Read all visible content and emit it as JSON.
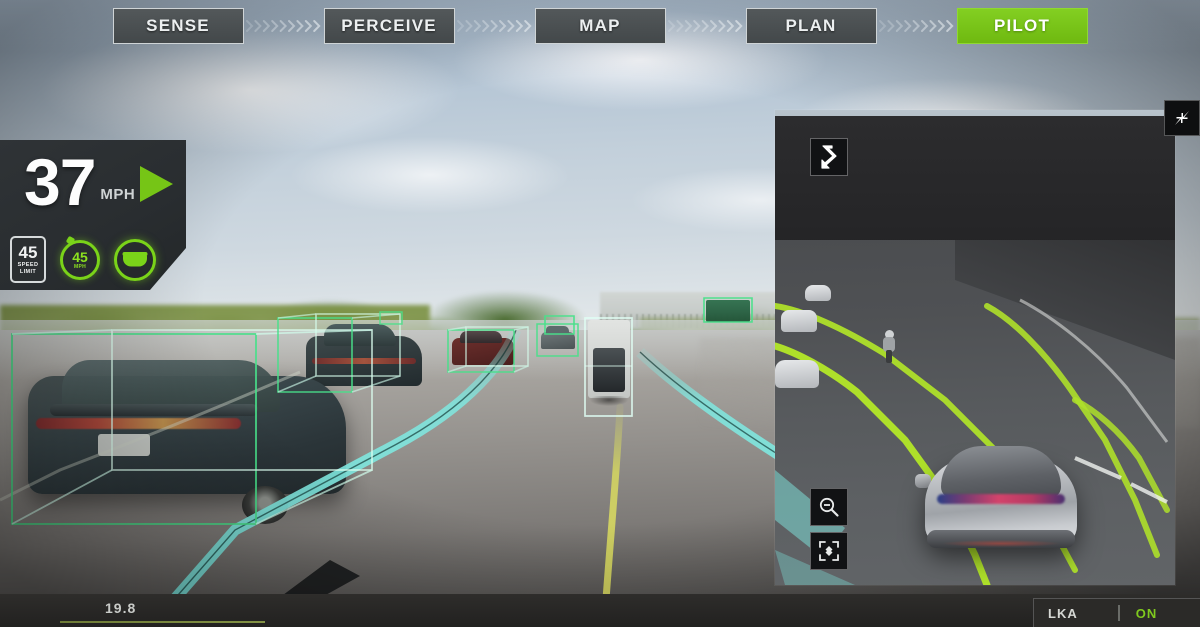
{
  "pipeline": {
    "steps": [
      {
        "label": "SENSE",
        "active": false,
        "name": "pipeline-step-sense"
      },
      {
        "label": "PERCEIVE",
        "active": false,
        "name": "pipeline-step-perceive"
      },
      {
        "label": "MAP",
        "active": false,
        "name": "pipeline-step-map"
      },
      {
        "label": "PLAN",
        "active": false,
        "name": "pipeline-step-plan"
      },
      {
        "label": "PILOT",
        "active": true,
        "name": "pipeline-step-pilot"
      }
    ],
    "separator_icon": "chevron-right-arrows-icon",
    "active_color": "#76c516",
    "inactive_color": "#4a4e50"
  },
  "hud": {
    "speed_value": "37",
    "speed_unit": "MPH",
    "direction_indicator_icon": "green-right-arrow-icon",
    "speed_limit_sign": {
      "value": "45",
      "line1": "SPEED",
      "line2": "LIMIT"
    },
    "cruise_control": {
      "value": "45",
      "unit": "MPH",
      "state_color": "#7ad319"
    },
    "steering_icon": "steering-wheel-icon",
    "steering_state_color": "#7ad319"
  },
  "minimap": {
    "maneuver_icon": "lane-change-merge-left-icon",
    "collapse_icon": "collapse-arrows-icon",
    "zoom_out_icon": "magnifier-minus-icon",
    "fit_icon": "fit-to-screen-icon",
    "lane_color": "#aee02a",
    "ego_vehicle": "silver-concept-car",
    "detected_objects": [
      "vehicle",
      "vehicle",
      "vehicle",
      "motorcyclist"
    ]
  },
  "scene": {
    "lane_overlay_color": "#7fe8e0",
    "detection_box_color": "#49e08a",
    "center_line_color": "#d8d860",
    "detections": [
      {
        "name": "detection-box-ego-lead-sedan"
      },
      {
        "name": "detection-box-left-sedan"
      },
      {
        "name": "detection-box-red-car"
      },
      {
        "name": "detection-box-far-car"
      },
      {
        "name": "detection-box-truck"
      },
      {
        "name": "detection-box-highway-sign"
      }
    ]
  },
  "bottom_bar": {
    "odometer": "19.8",
    "lka_label": "LKA",
    "lka_state": "ON",
    "lka_state_color": "#7fc91e"
  }
}
